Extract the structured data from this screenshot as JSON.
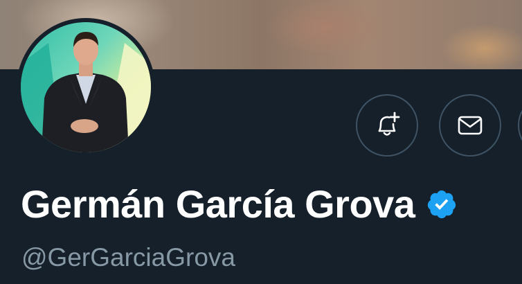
{
  "profile": {
    "display_name": "Germán García Grova",
    "handle": "@GerGarciaGrova",
    "verified": true
  },
  "actions": {
    "notifications_icon": "bell-plus-icon",
    "message_icon": "mail-icon"
  },
  "colors": {
    "background": "#15202b",
    "verified_badge": "#1da1f2",
    "handle_text": "#8899a6",
    "button_border": "#3f5364"
  }
}
